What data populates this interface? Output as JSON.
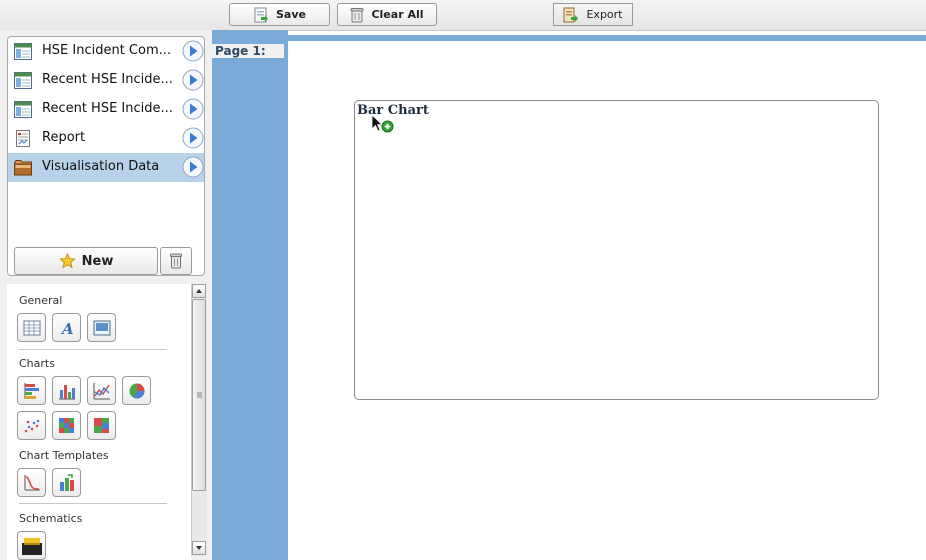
{
  "toolbar": {
    "save_label": "Save",
    "clear_all_label": "Clear All",
    "export_label": "Export"
  },
  "datasources": {
    "items": [
      {
        "label": "HSE Incident Com...",
        "icon": "table-icon"
      },
      {
        "label": "Recent HSE Incide...",
        "icon": "table-icon"
      },
      {
        "label": "Recent HSE Incide...",
        "icon": "table-icon"
      },
      {
        "label": "Report",
        "icon": "report-icon"
      },
      {
        "label": "Visualisation Data",
        "icon": "folder-icon",
        "selected": true
      }
    ],
    "new_label": "New"
  },
  "palette": {
    "general": "General",
    "charts": "Charts",
    "chart_templates": "Chart Templates",
    "schematics": "Schematics"
  },
  "canvas": {
    "page_label": "Page 1:",
    "chart_title": "Bar Chart"
  },
  "colors": {
    "accent": "#7aabd8",
    "selection": "#b8d2ea",
    "arrow_blue": "#3a7bd5",
    "add_green": "#2fa52f"
  }
}
